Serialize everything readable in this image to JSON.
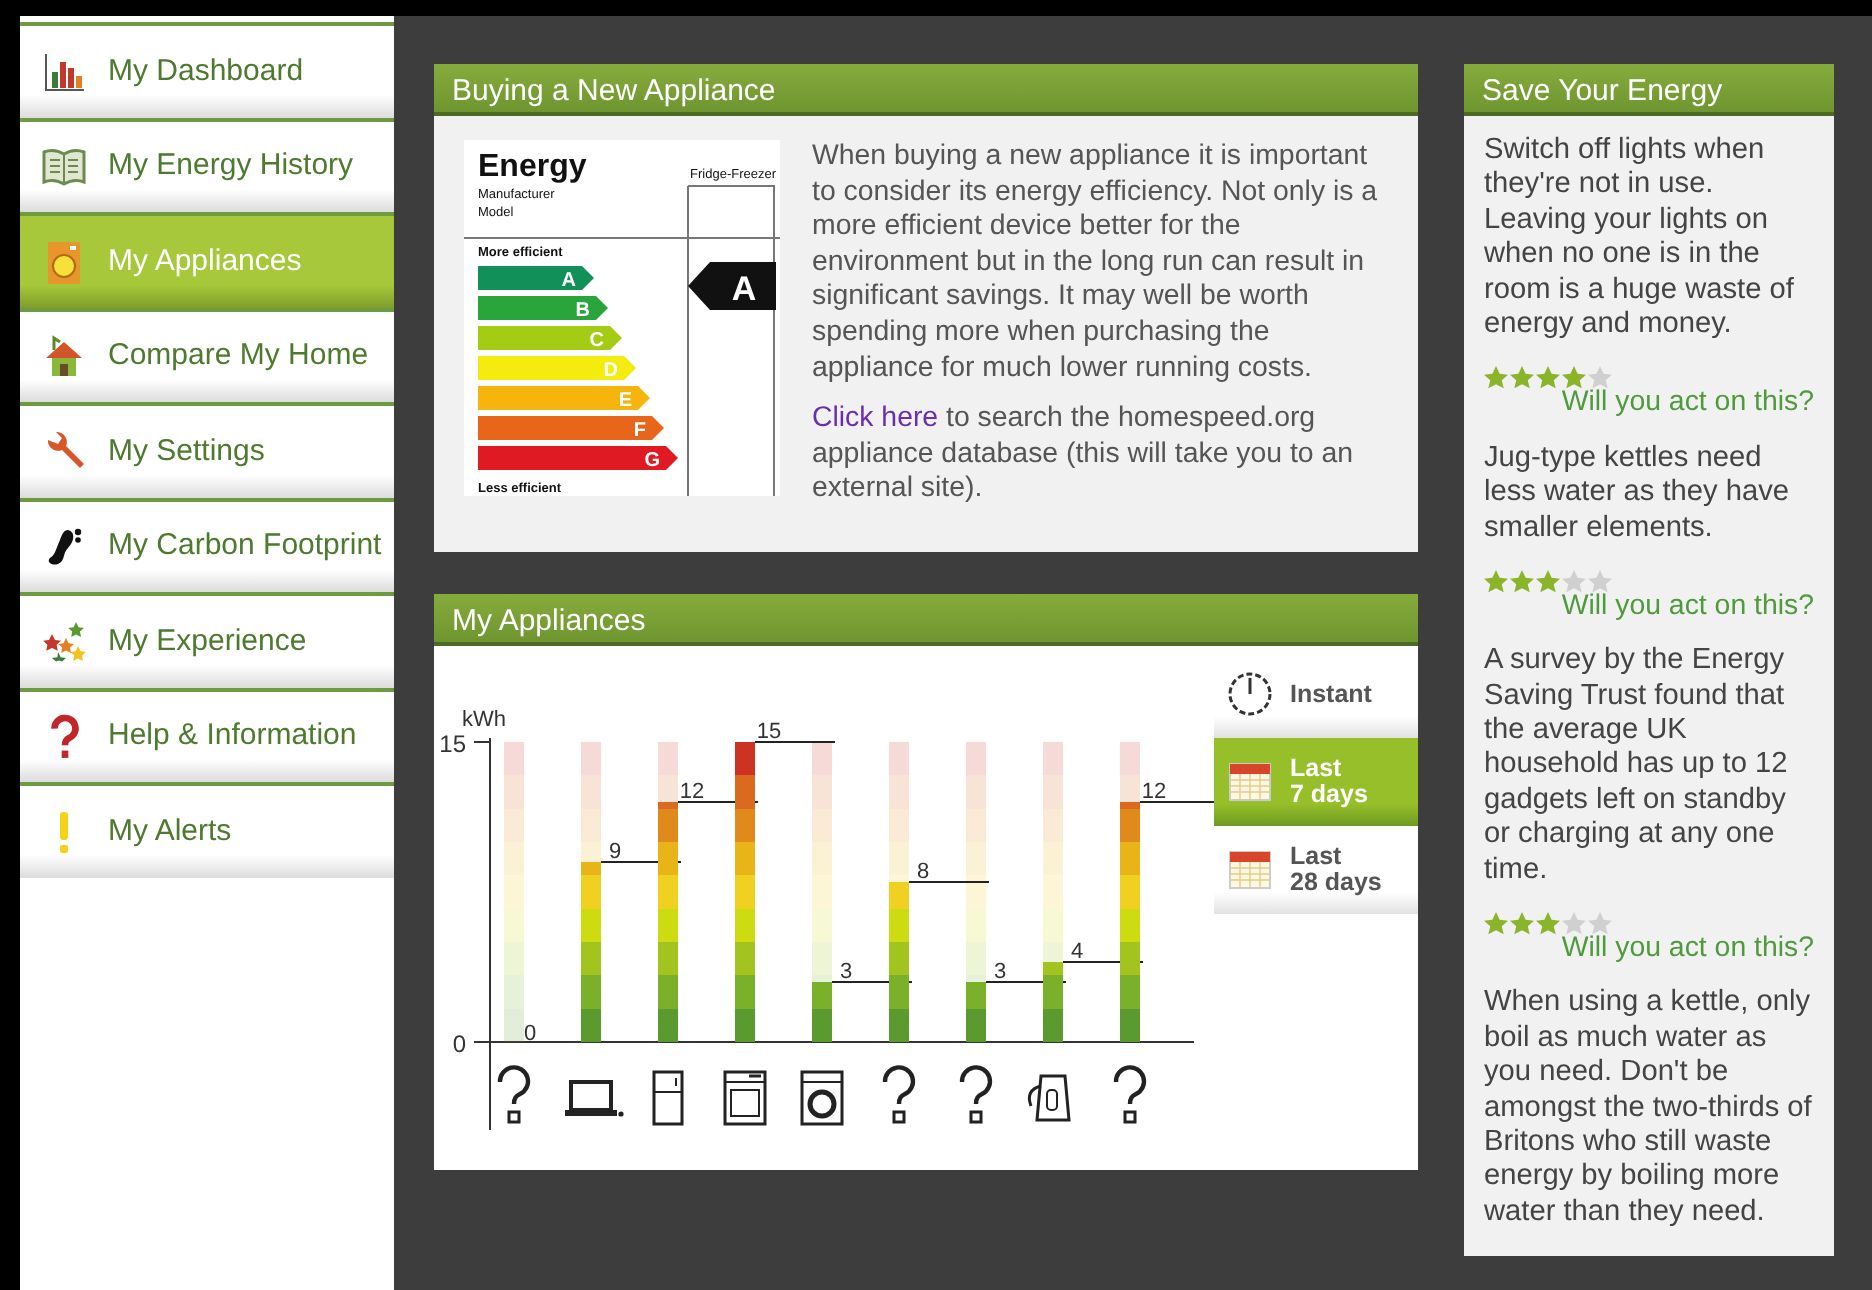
{
  "sidebar": {
    "items": [
      {
        "label": "My Dashboard",
        "kind": "chart",
        "selected": false
      },
      {
        "label": "My Energy History",
        "kind": "book",
        "selected": false
      },
      {
        "label": "My Appliances",
        "kind": "appliance",
        "selected": true
      },
      {
        "label": "Compare My Home",
        "kind": "house",
        "selected": false
      },
      {
        "label": "My Settings",
        "kind": "wrench",
        "selected": false
      },
      {
        "label": "My Carbon Footprint",
        "kind": "footprint",
        "selected": false
      },
      {
        "label": "My Experience",
        "kind": "stars",
        "selected": false
      },
      {
        "label": "Help & Information",
        "kind": "help",
        "selected": false
      },
      {
        "label": "My Alerts",
        "kind": "alert",
        "selected": false
      }
    ]
  },
  "buying_panel": {
    "title": "Buying a New Appliance",
    "energy_label": {
      "title": "Energy",
      "lines": [
        "Manufacturer",
        "Model"
      ],
      "appliance": "Fridge-Freezer",
      "top_caption": "More efficient",
      "bottom_caption": "Less efficient",
      "bands": [
        "A",
        "B",
        "C",
        "D",
        "E",
        "F",
        "G"
      ],
      "rating": "A"
    },
    "paragraph": "When buying a new appliance it is important to consider its energy efficiency. Not only is a more efficient device better for the environment but in the long run can result in significant savings. It may well be worth spending more when purchasing the appliance for much lower running costs.",
    "link": "Click here",
    "link_tail": "to search the homespeed.org appliance database (this will take you to an external site)."
  },
  "appliances_panel": {
    "title": "My Appliances",
    "chart_data": {
      "type": "bar",
      "ylabel": "kWh",
      "ylim": [
        0,
        15
      ],
      "yticks": [
        0,
        15
      ],
      "values": [
        0,
        9,
        12,
        15,
        3,
        8,
        3,
        4,
        12
      ],
      "data_labels": true
    },
    "appliances": [
      {
        "kind": "unknown"
      },
      {
        "kind": "laptop"
      },
      {
        "kind": "fridge"
      },
      {
        "kind": "oven"
      },
      {
        "kind": "washer"
      },
      {
        "kind": "unknown"
      },
      {
        "kind": "unknown"
      },
      {
        "kind": "kettle"
      },
      {
        "kind": "unknown"
      }
    ],
    "periods": [
      {
        "label": "Instant",
        "kind": "clock",
        "selected": false
      },
      {
        "label": "Last\n7 days",
        "kind": "calendar",
        "selected": true
      },
      {
        "label": "Last\n28 days",
        "kind": "calendar",
        "selected": false
      }
    ]
  },
  "save_panel": {
    "title": "Save Your Energy",
    "tips": [
      {
        "text": "Switch off lights when they're not in use. Leaving your lights on when no one is in the room is a huge waste of energy and money.",
        "stars": 4,
        "action": "Will you act on this?"
      },
      {
        "text": "Jug-type kettles need less water as they have smaller elements.",
        "stars": 3,
        "action": "Will you act on this?"
      },
      {
        "text": "A survey by the Energy Saving Trust found that the average UK household has up to 12 gadgets left on standby or charging at any one time.",
        "stars": 3,
        "action": "Will you act on this?"
      },
      {
        "text": "When using a kettle, only boil as much water as you need. Don't be amongst the two-thirds of Britons who still waste energy by boiling more water than they need."
      }
    ]
  }
}
